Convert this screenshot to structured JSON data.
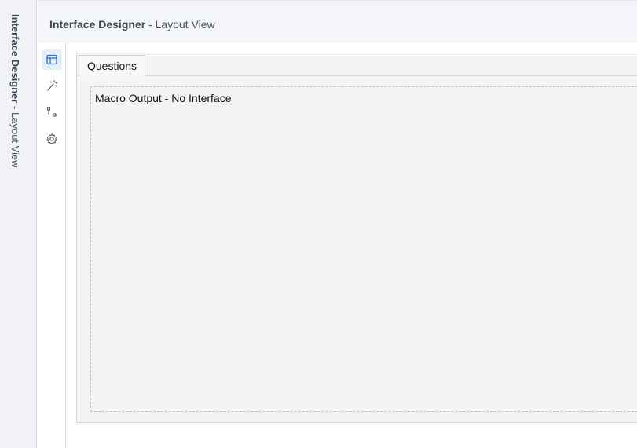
{
  "side_tab": {
    "title": "Interface Designer",
    "separator": " - ",
    "subtitle": "Layout View"
  },
  "header": {
    "title": "Interface Designer",
    "separator": " - ",
    "subtitle": "Layout View"
  },
  "icon_rail": {
    "items": [
      {
        "icon": "layout-icon",
        "active": true
      },
      {
        "icon": "magic-wand-icon",
        "active": false
      },
      {
        "icon": "tree-icon",
        "active": false
      },
      {
        "icon": "gear-icon",
        "active": false
      }
    ]
  },
  "panel": {
    "tab_label": "Questions",
    "canvas_label": "Macro Output - No Interface"
  },
  "colors": {
    "accent": "#2b6cc4",
    "icon": "#555d68"
  }
}
